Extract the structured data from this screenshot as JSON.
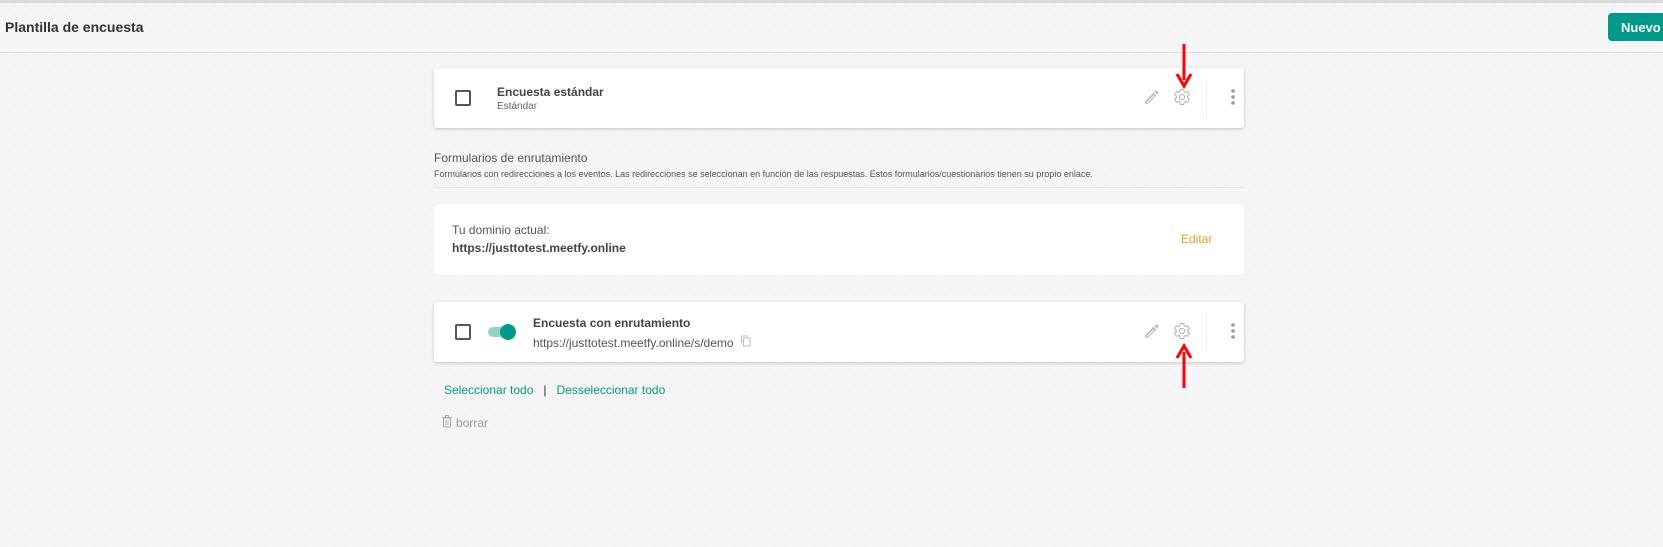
{
  "header": {
    "title": "Plantilla de encuesta",
    "new_button": "Nuevo"
  },
  "standard_survey": {
    "title": "Encuesta estándar",
    "subtitle": "Estándar"
  },
  "routing_section": {
    "title": "Formularios de enrutamiento",
    "description": "Formularios con redirecciones a los eventos. Las redirecciones se seleccionan en función de las respuestas. Estos formularios/cuestionarios tienen su propio enlace."
  },
  "domain": {
    "label": "Tu dominio actual:",
    "value": "https://justtotest.meetfy.online",
    "edit": "Editar"
  },
  "routing_survey": {
    "title": "Encuesta con enrutamiento",
    "url": "https://justtotest.meetfy.online/s/demo",
    "enabled": true
  },
  "actions": {
    "select_all": "Seleccionar todo",
    "separator": "|",
    "deselect_all": "Desseleccionar todo",
    "delete": "borrar"
  },
  "colors": {
    "accent": "#00998a",
    "edit": "#f0a020",
    "annotation_arrow": "#ff0000"
  },
  "icons": [
    "pencil-icon",
    "gear-icon",
    "kebab-menu-icon",
    "copy-icon",
    "trash-icon"
  ]
}
